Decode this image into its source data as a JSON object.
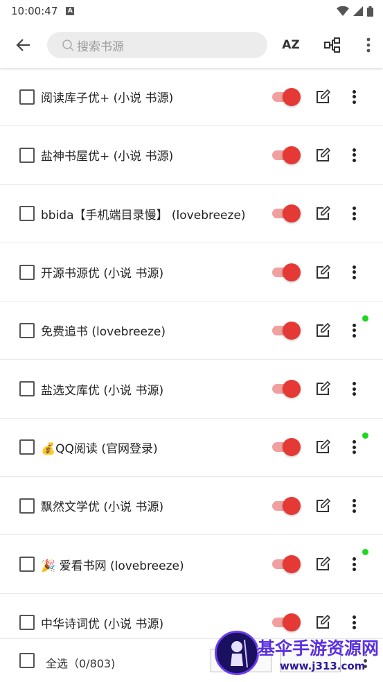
{
  "status_bar": {
    "time": "10:00:47",
    "notif_icon": "a-icon"
  },
  "toolbar": {
    "back_icon": "arrow-left-icon",
    "search_placeholder": "搜索书源",
    "sort_label": "AZ"
  },
  "sources": [
    {
      "label": "阅读库子优+ (小说 书源)",
      "enabled": true,
      "new_dot": false
    },
    {
      "label": "盐神书屋优+ (小说 书源)",
      "enabled": true,
      "new_dot": false
    },
    {
      "label": "bbida【手机端目录慢】 (lovebreeze)",
      "enabled": true,
      "new_dot": false
    },
    {
      "label": "开源书源优 (小说 书源)",
      "enabled": true,
      "new_dot": false
    },
    {
      "label": "免费追书 (lovebreeze)",
      "enabled": true,
      "new_dot": true
    },
    {
      "label": "盐选文库优 (小说 书源)",
      "enabled": true,
      "new_dot": false
    },
    {
      "label": "💰QQ阅读 (官网登录)",
      "enabled": true,
      "new_dot": true
    },
    {
      "label": "飘然文学优 (小说 书源)",
      "enabled": true,
      "new_dot": false
    },
    {
      "label": "🎉 爱看书网 (lovebreeze)",
      "enabled": true,
      "new_dot": true
    },
    {
      "label": "中华诗词优 (小说 书源)",
      "enabled": true,
      "new_dot": false
    }
  ],
  "bottom_bar": {
    "select_all_label": "全选（0/803)",
    "watermark_title": "基伞手游资源网",
    "watermark_url": "www.j313.com"
  },
  "colors": {
    "accent": "#e53935",
    "track": "#f1a0a0",
    "new_dot": "#1ed71e"
  }
}
